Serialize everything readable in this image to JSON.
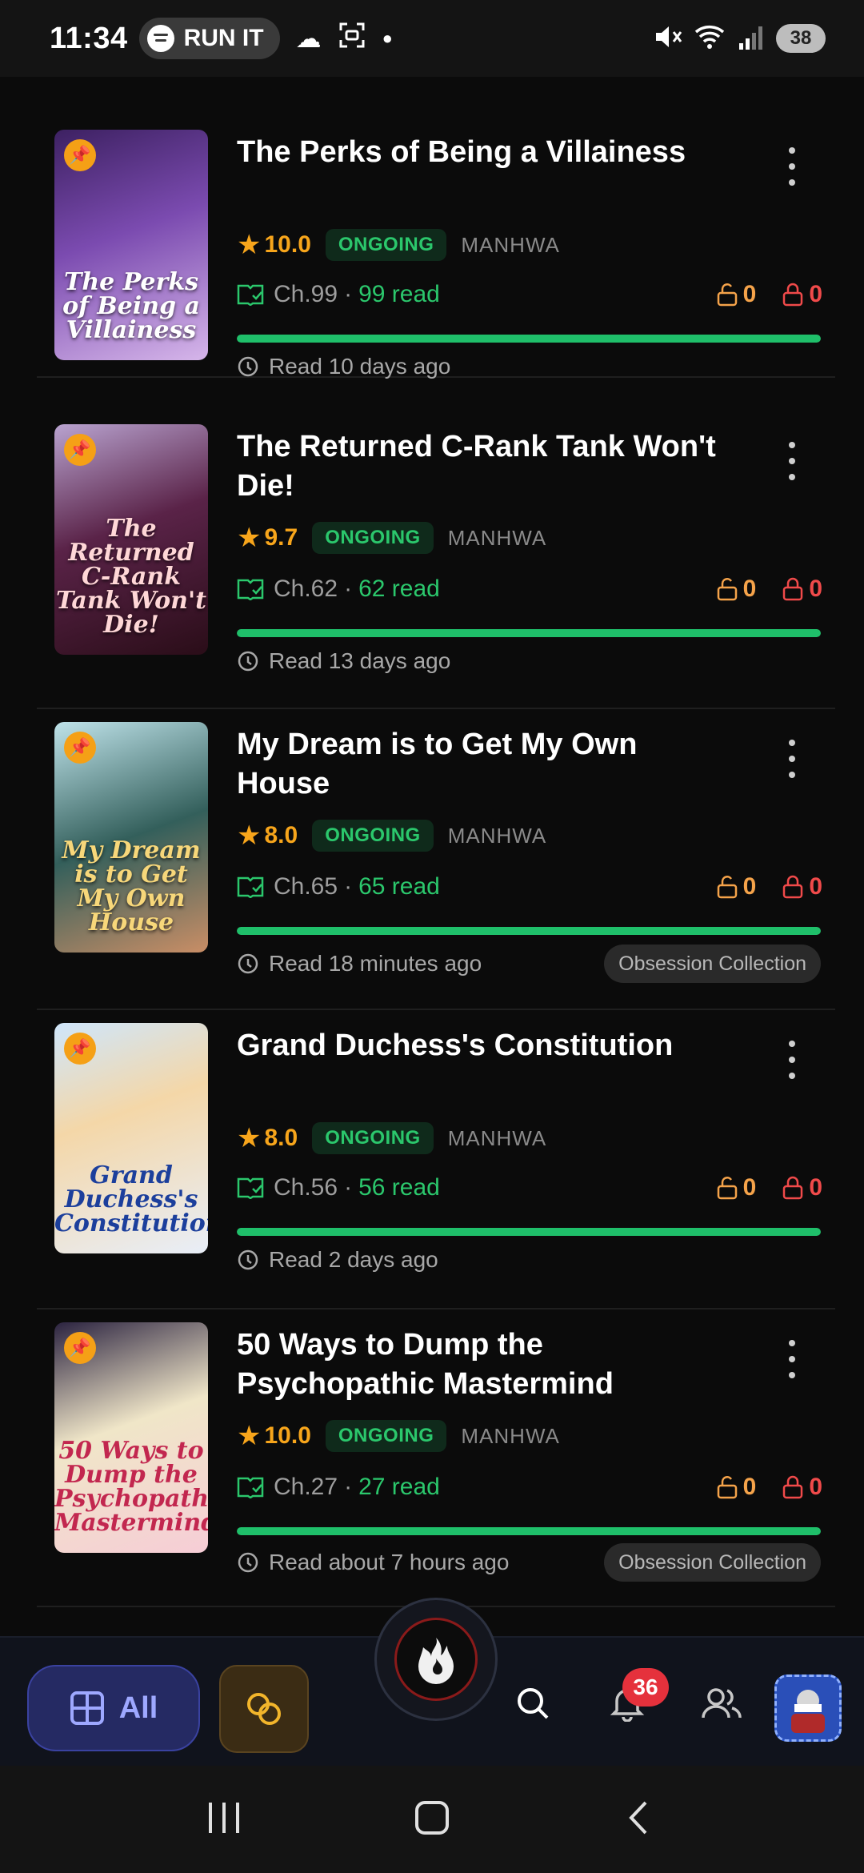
{
  "status_bar": {
    "time": "11:34",
    "spotify_label": "RUN IT",
    "battery": "38"
  },
  "cards": [
    {
      "title": "The Perks of Being a Villainess",
      "cover_text": "The Perks of Being a Villainess",
      "cover_colors": [
        "#6b3a9b",
        "#c9a0e0"
      ],
      "rating": "10.0",
      "status": "ONGOING",
      "type": "MANHWA",
      "chapter": "Ch.99",
      "read": "99 read",
      "unlocked": "0",
      "locked": "0",
      "progress": 1.0,
      "last_read": "Read 10 days ago",
      "collection": ""
    },
    {
      "title": "The Returned C-Rank Tank Won't Die!",
      "cover_text": "The Returned C-Rank Tank Won't Die!",
      "cover_colors": [
        "#4a1230",
        "#b7a0c8"
      ],
      "rating": "9.7",
      "status": "ONGOING",
      "type": "MANHWA",
      "chapter": "Ch.62",
      "read": "62 read",
      "unlocked": "0",
      "locked": "0",
      "progress": 1.0,
      "last_read": "Read 13 days ago",
      "collection": ""
    },
    {
      "title": "My Dream is to Get My Own House",
      "cover_text": "My Dream is to Get My Own House",
      "cover_colors": [
        "#2f6f6a",
        "#c9b08f"
      ],
      "rating": "8.0",
      "status": "ONGOING",
      "type": "MANHWA",
      "chapter": "Ch.65",
      "read": "65 read",
      "unlocked": "0",
      "locked": "0",
      "progress": 1.0,
      "last_read": "Read 18 minutes ago",
      "collection": "Obsession Collection"
    },
    {
      "title": "Grand Duchess's Constitution",
      "cover_text": "Grand Duchess's Constitution",
      "cover_colors": [
        "#8fc3e8",
        "#e9eef8"
      ],
      "rating": "8.0",
      "status": "ONGOING",
      "type": "MANHWA",
      "chapter": "Ch.56",
      "read": "56 read",
      "unlocked": "0",
      "locked": "0",
      "progress": 1.0,
      "last_read": "Read 2 days ago",
      "collection": ""
    },
    {
      "title": "50 Ways to Dump the Psychopathic Mastermind",
      "cover_text": "50 Ways to Dump the Psychopathic Mastermind",
      "cover_colors": [
        "#2a2440",
        "#f1c9cf"
      ],
      "rating": "10.0",
      "status": "ONGOING",
      "type": "MANHWA",
      "chapter": "Ch.27",
      "read": "27 read",
      "unlocked": "0",
      "locked": "0",
      "progress": 1.0,
      "last_read": "Read about 7 hours ago",
      "collection": "Obsession Collection"
    }
  ],
  "bottom_nav": {
    "all_label": "All",
    "notification_count": "36",
    "icons": [
      "grid-icon",
      "coins-icon",
      "flame-icon",
      "search-icon",
      "bell-icon",
      "users-icon",
      "avatar"
    ]
  },
  "colors": {
    "accent_green": "#1fbf6a",
    "rating_orange": "#f7a51b",
    "locked_red": "#f04a4a",
    "nav_purple": "#252a63"
  }
}
